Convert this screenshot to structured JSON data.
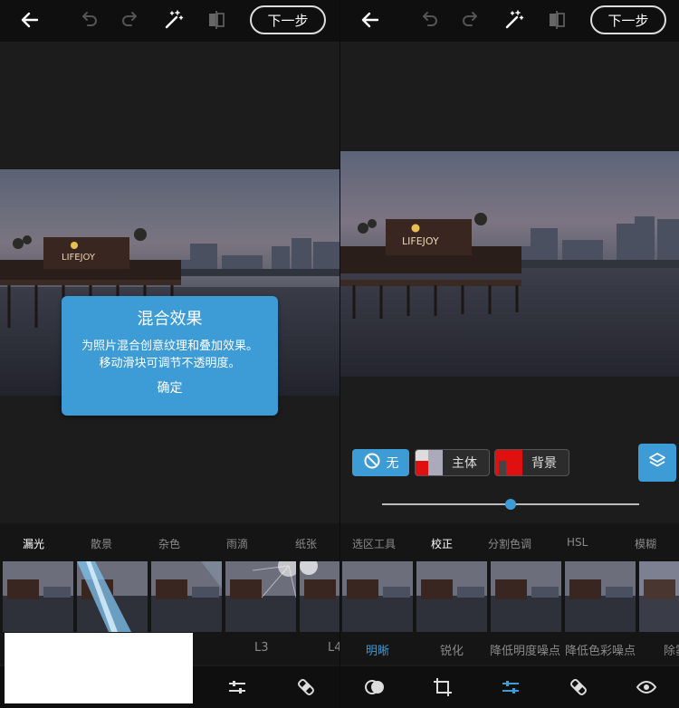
{
  "left": {
    "topbar": {
      "next_label": "下一步"
    },
    "tooltip": {
      "title": "混合效果",
      "body": "为照片混合创意纹理和叠加效果。移动滑块可调节不透明度。",
      "confirm": "确定"
    },
    "categories": [
      {
        "label": "漏光",
        "active": true
      },
      {
        "label": "散景",
        "active": false
      },
      {
        "label": "杂色",
        "active": false
      },
      {
        "label": "雨滴",
        "active": false
      },
      {
        "label": "纸张",
        "active": false
      }
    ],
    "item_labels": [
      "L3",
      "L4"
    ],
    "photo_sign": "LIFEJOY"
  },
  "right": {
    "topbar": {
      "next_label": "下一步"
    },
    "segments": {
      "none": "无",
      "subject": "主体",
      "background": "背景"
    },
    "slider_value": 0.5,
    "categories": [
      {
        "label": "选区工具",
        "active": false
      },
      {
        "label": "校正",
        "active": true
      },
      {
        "label": "分割色调",
        "active": false
      },
      {
        "label": "HSL",
        "active": false
      },
      {
        "label": "模糊",
        "active": false
      }
    ],
    "item_labels": [
      {
        "label": "明晰",
        "active": true
      },
      {
        "label": "锐化",
        "active": false
      },
      {
        "label": "降低明度噪点",
        "active": false
      },
      {
        "label": "降低色彩噪点",
        "active": false
      },
      {
        "label": "除雾",
        "active": false
      }
    ],
    "photo_sign": "LIFEJOY"
  },
  "colors": {
    "accent": "#3d9bd6",
    "bar": "#0f0f0f",
    "mask_red": "#e01010"
  },
  "icons": {
    "back": "arrow-left-icon",
    "undo": "undo-icon",
    "redo": "redo-icon",
    "auto": "magic-wand-icon",
    "compare": "compare-icon",
    "adjust": "sliders-icon",
    "heal": "bandage-icon",
    "blend": "overlapping-circles-icon",
    "crop": "crop-icon",
    "layers": "layers-icon",
    "eye": "eye-icon",
    "none": "no-symbol-icon"
  }
}
